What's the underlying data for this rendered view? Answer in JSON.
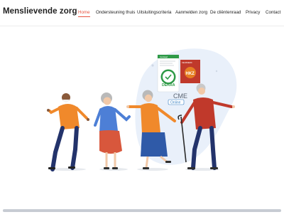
{
  "brand": {
    "name": "Menslievende zorg"
  },
  "nav": {
    "items": [
      {
        "label": "Home",
        "active": true
      },
      {
        "label": "Ondersteuning thuis",
        "active": false
      },
      {
        "label": "Uitsluitingscriteria",
        "active": false
      },
      {
        "label": "Aanmelden zorg",
        "active": false
      },
      {
        "label": "De cliëntenraad",
        "active": false
      },
      {
        "label": "Privacy",
        "active": false
      },
      {
        "label": "Contact",
        "active": false
      }
    ],
    "active_color": "#e8533f"
  },
  "hero": {
    "certifications": {
      "dekra": {
        "top_text": "Geslaagd",
        "brand": "DEKRA"
      },
      "hkz": {
        "title": "KEURMERK",
        "initials": "HKZ"
      },
      "cme": {
        "label": "CME",
        "sublabel": "Online"
      }
    },
    "illustration": {
      "description_icon": "dancing-seniors-illustration",
      "blob_color": "#e9f0fa"
    }
  }
}
